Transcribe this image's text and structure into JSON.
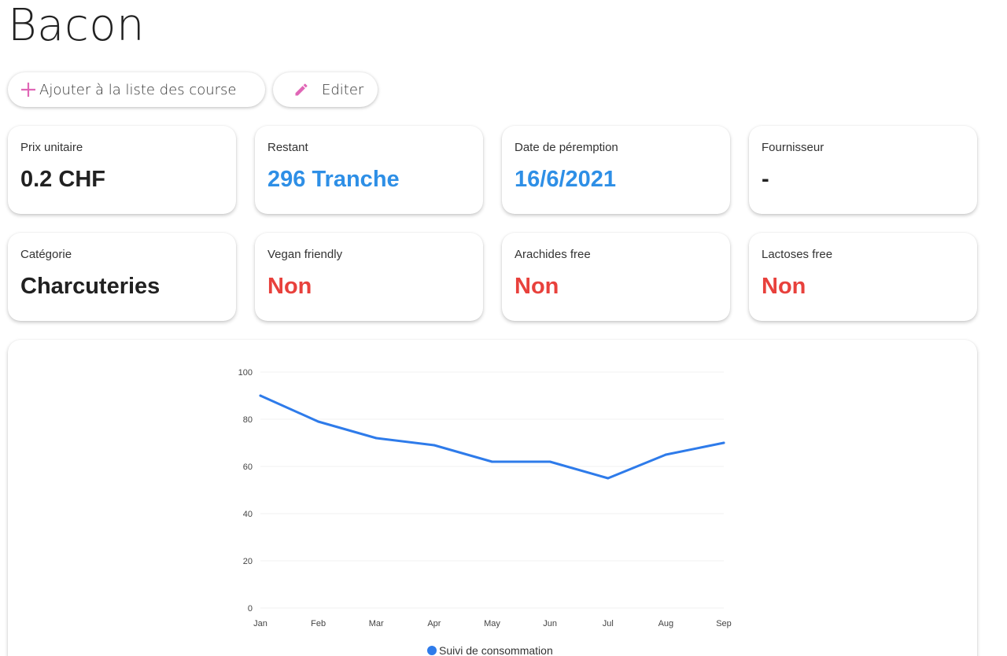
{
  "product": {
    "title": "Bacon"
  },
  "actions": {
    "add_to_list_label": "Ajouter à la liste des course",
    "edit_label": "Editer",
    "add_icon": "plus-icon",
    "edit_icon": "pencil-icon",
    "icon_color": "#e066b6"
  },
  "cards": [
    {
      "label": "Prix unitaire",
      "value": "0.2 CHF",
      "color": "#212121"
    },
    {
      "label": "Restant",
      "value": "296 Tranche",
      "color": "#2e8fe6"
    },
    {
      "label": "Date de péremption",
      "value": "16/6/2021",
      "color": "#2e8fe6"
    },
    {
      "label": "Fournisseur",
      "value": "-",
      "color": "#212121"
    },
    {
      "label": "Catégorie",
      "value": "Charcuteries",
      "color": "#212121"
    },
    {
      "label": "Vegan friendly",
      "value": "Non",
      "color": "#e8413c"
    },
    {
      "label": "Arachides free",
      "value": "Non",
      "color": "#e8413c"
    },
    {
      "label": "Lactoses free",
      "value": "Non",
      "color": "#e8413c"
    }
  ],
  "chart_data": {
    "type": "line",
    "categories": [
      "Jan",
      "Feb",
      "Mar",
      "Apr",
      "May",
      "Jun",
      "Jul",
      "Aug",
      "Sep"
    ],
    "series": [
      {
        "name": "Suivi de consommation",
        "values": [
          90,
          79,
          72,
          69,
          62,
          62,
          55,
          65,
          70
        ],
        "color": "#2e7bea"
      }
    ],
    "ylim": [
      0,
      100
    ],
    "yticks": [
      0,
      20,
      40,
      60,
      80,
      100
    ],
    "grid": true,
    "legend_position": "bottom"
  }
}
